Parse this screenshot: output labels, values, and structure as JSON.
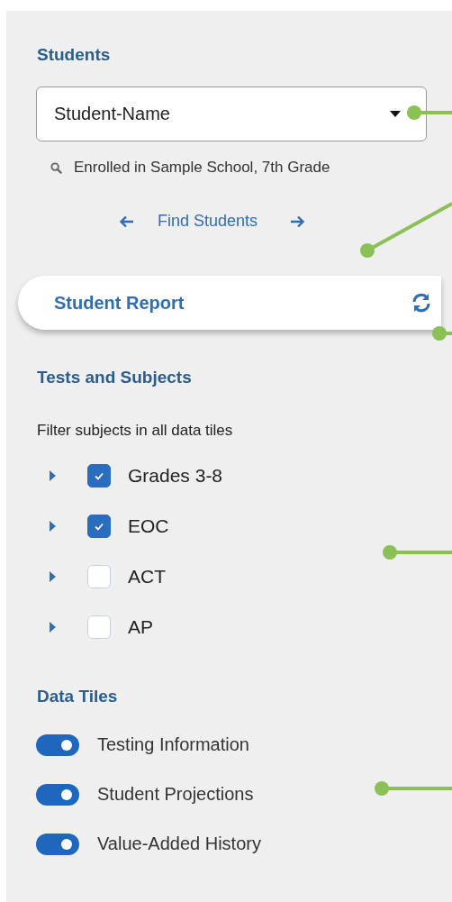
{
  "students": {
    "heading": "Students",
    "dropdown_value": "Student-Name",
    "enrollment": "Enrolled in Sample School, 7th Grade",
    "find_link": "Find Students"
  },
  "report_bar": {
    "title": "Student Report"
  },
  "tests_and_subjects": {
    "heading": "Tests and Subjects",
    "hint": "Filter subjects in all data tiles",
    "items": [
      {
        "label": "Grades 3-8",
        "checked": true,
        "expanded": false
      },
      {
        "label": "EOC",
        "checked": true,
        "expanded": false
      },
      {
        "label": "ACT",
        "checked": false,
        "expanded": false
      },
      {
        "label": "AP",
        "checked": false,
        "expanded": false
      }
    ]
  },
  "data_tiles": {
    "heading": "Data Tiles",
    "items": [
      {
        "label": "Testing Information",
        "on": true
      },
      {
        "label": "Student Projections",
        "on": true
      },
      {
        "label": "Value-Added History",
        "on": true
      }
    ]
  }
}
